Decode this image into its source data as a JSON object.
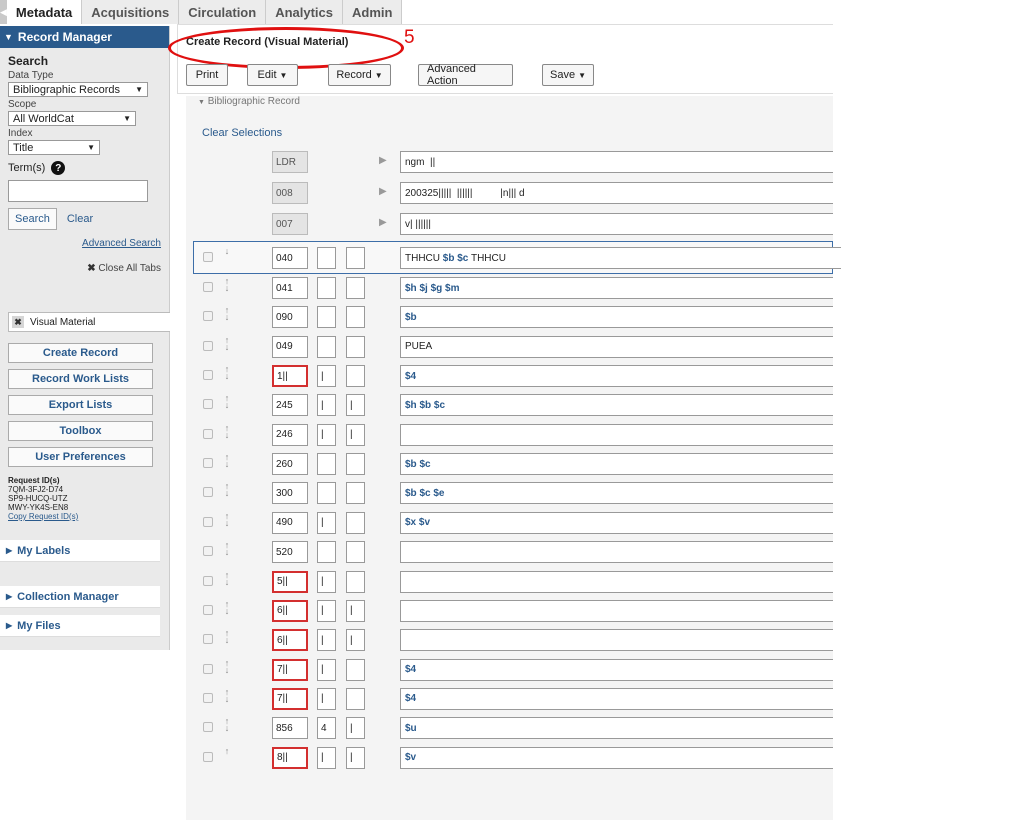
{
  "nav": {
    "collapse_glyph": "◀",
    "tabs": [
      "Metadata",
      "Acquisitions",
      "Circulation",
      "Analytics",
      "Admin"
    ]
  },
  "sidebar": {
    "record_manager": "Record Manager",
    "search_title": "Search",
    "data_type_label": "Data Type",
    "data_type_value": "Bibliographic Records",
    "scope_label": "Scope",
    "scope_value": "All WorldCat",
    "index_label": "Index",
    "index_value": "Title",
    "terms_label": "Term(s)",
    "search_button": "Search",
    "clear_link": "Clear",
    "advanced_search": "Advanced Search",
    "close_all_tabs": "Close All Tabs",
    "open_tab": "Visual Material",
    "buttons": [
      "Create Record",
      "Record Work Lists",
      "Export Lists",
      "Toolbox",
      "User Preferences"
    ],
    "request_ids_title": "Request ID(s)",
    "request_ids": [
      "7QM-3FJ2-D74",
      "SP9-HUCQ-UTZ",
      "MWY-YK4S-EN8"
    ],
    "copy_request_ids": "Copy Request ID(s)",
    "my_labels": "My Labels",
    "collection_manager": "Collection Manager",
    "my_files": "My Files"
  },
  "main": {
    "record_title": "Create Record (Visual Material)",
    "annotation_number": "5",
    "toolbar": {
      "print": "Print",
      "edit": "Edit",
      "record": "Record",
      "advanced_action": "Advanced Action",
      "save": "Save"
    },
    "section_label": "Bibliographic Record",
    "clear_selections": "Clear Selections",
    "fixed_fields": [
      {
        "tag": "LDR",
        "value": "ngm  ||"
      },
      {
        "tag": "008",
        "value": "200325|||||  ||||||          |n||| d"
      },
      {
        "tag": "007",
        "value": "v| ||||||"
      }
    ],
    "variable_fields": [
      {
        "tag": "040",
        "ind1": "",
        "ind2": "",
        "pre": "THHCU ",
        "subs": [
          {
            "code": "$b",
            "text": " "
          },
          {
            "code": "$c",
            "text": " THHCU"
          }
        ],
        "red": false
      },
      {
        "tag": "041",
        "ind1": "",
        "ind2": "",
        "pre": "",
        "subs": [
          {
            "code": "$h",
            "text": " "
          },
          {
            "code": "$j",
            "text": " "
          },
          {
            "code": "$g",
            "text": " "
          },
          {
            "code": "$m",
            "text": ""
          }
        ],
        "red": false
      },
      {
        "tag": "090",
        "ind1": "",
        "ind2": "",
        "pre": "",
        "subs": [
          {
            "code": "$b",
            "text": ""
          }
        ],
        "red": false
      },
      {
        "tag": "049",
        "ind1": "",
        "ind2": "",
        "pre": "PUEA",
        "subs": [],
        "red": false
      },
      {
        "tag": "1||",
        "ind1": "|",
        "ind2": "",
        "pre": "",
        "subs": [
          {
            "code": "$4",
            "text": ""
          }
        ],
        "red": true
      },
      {
        "tag": "245",
        "ind1": "|",
        "ind2": "|",
        "pre": "",
        "subs": [
          {
            "code": "$h",
            "text": " "
          },
          {
            "code": "$b",
            "text": " "
          },
          {
            "code": "$c",
            "text": ""
          }
        ],
        "red": false
      },
      {
        "tag": "246",
        "ind1": "|",
        "ind2": "|",
        "pre": "",
        "subs": [],
        "red": false
      },
      {
        "tag": "260",
        "ind1": "",
        "ind2": "",
        "pre": "",
        "subs": [
          {
            "code": "$b",
            "text": " "
          },
          {
            "code": "$c",
            "text": ""
          }
        ],
        "red": false
      },
      {
        "tag": "300",
        "ind1": "",
        "ind2": "",
        "pre": "",
        "subs": [
          {
            "code": "$b",
            "text": " "
          },
          {
            "code": "$c",
            "text": " "
          },
          {
            "code": "$e",
            "text": ""
          }
        ],
        "red": false
      },
      {
        "tag": "490",
        "ind1": "|",
        "ind2": "",
        "pre": "",
        "subs": [
          {
            "code": "$x",
            "text": " "
          },
          {
            "code": "$v",
            "text": ""
          }
        ],
        "red": false
      },
      {
        "tag": "520",
        "ind1": "",
        "ind2": "",
        "pre": "",
        "subs": [],
        "red": false
      },
      {
        "tag": "5||",
        "ind1": "|",
        "ind2": "",
        "pre": "",
        "subs": [],
        "red": true
      },
      {
        "tag": "6||",
        "ind1": "|",
        "ind2": "|",
        "pre": "",
        "subs": [],
        "red": true
      },
      {
        "tag": "6||",
        "ind1": "|",
        "ind2": "|",
        "pre": "",
        "subs": [],
        "red": true
      },
      {
        "tag": "7||",
        "ind1": "|",
        "ind2": "",
        "pre": "",
        "subs": [
          {
            "code": "$4",
            "text": ""
          }
        ],
        "red": true
      },
      {
        "tag": "7||",
        "ind1": "|",
        "ind2": "",
        "pre": "",
        "subs": [
          {
            "code": "$4",
            "text": ""
          }
        ],
        "red": true
      },
      {
        "tag": "856",
        "ind1": "4",
        "ind2": "|",
        "pre": "",
        "subs": [
          {
            "code": "$u",
            "text": ""
          }
        ],
        "red": false
      },
      {
        "tag": "8||",
        "ind1": "|",
        "ind2": "|",
        "pre": "",
        "subs": [
          {
            "code": "$v",
            "text": ""
          }
        ],
        "red": true
      }
    ]
  }
}
